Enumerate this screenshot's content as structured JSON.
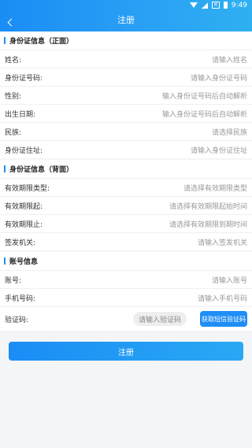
{
  "status": {
    "time": "9:49"
  },
  "header": {
    "title": "注册"
  },
  "sections": {
    "front": "身份证信息（正面）",
    "back": "身份证信息（背面）",
    "account": "账号信息"
  },
  "front_rows": [
    {
      "label": "姓名:",
      "value": "请输入姓名"
    },
    {
      "label": "身份证号码:",
      "value": "请输入身份证号码"
    },
    {
      "label": "性别:",
      "value": "输入身份证号码后自动解析"
    },
    {
      "label": "出生日期:",
      "value": "输入身份证号码后自动解析"
    },
    {
      "label": "民族:",
      "value": "请选择民族"
    },
    {
      "label": "身份证住址:",
      "value": "请输入身份证住址"
    }
  ],
  "back_rows": [
    {
      "label": "有效期限类型:",
      "value": "请选择有效期限类型"
    },
    {
      "label": "有效期限起:",
      "value": "请选择有效期限起始时间"
    },
    {
      "label": "有效期限止:",
      "value": "请选择有效期限到期时间"
    },
    {
      "label": "签发机关:",
      "value": "请输入签发机关"
    }
  ],
  "account_rows": [
    {
      "label": "账号:",
      "value": "请输入账号"
    },
    {
      "label": "手机号码:",
      "value": "请输入手机号码"
    }
  ],
  "code": {
    "label": "验证码:",
    "placeholder": "请输入验证码",
    "button": "获取短信验证码"
  },
  "submit": {
    "label": "注册"
  },
  "colors": {
    "accent": "#1f8ef5"
  }
}
